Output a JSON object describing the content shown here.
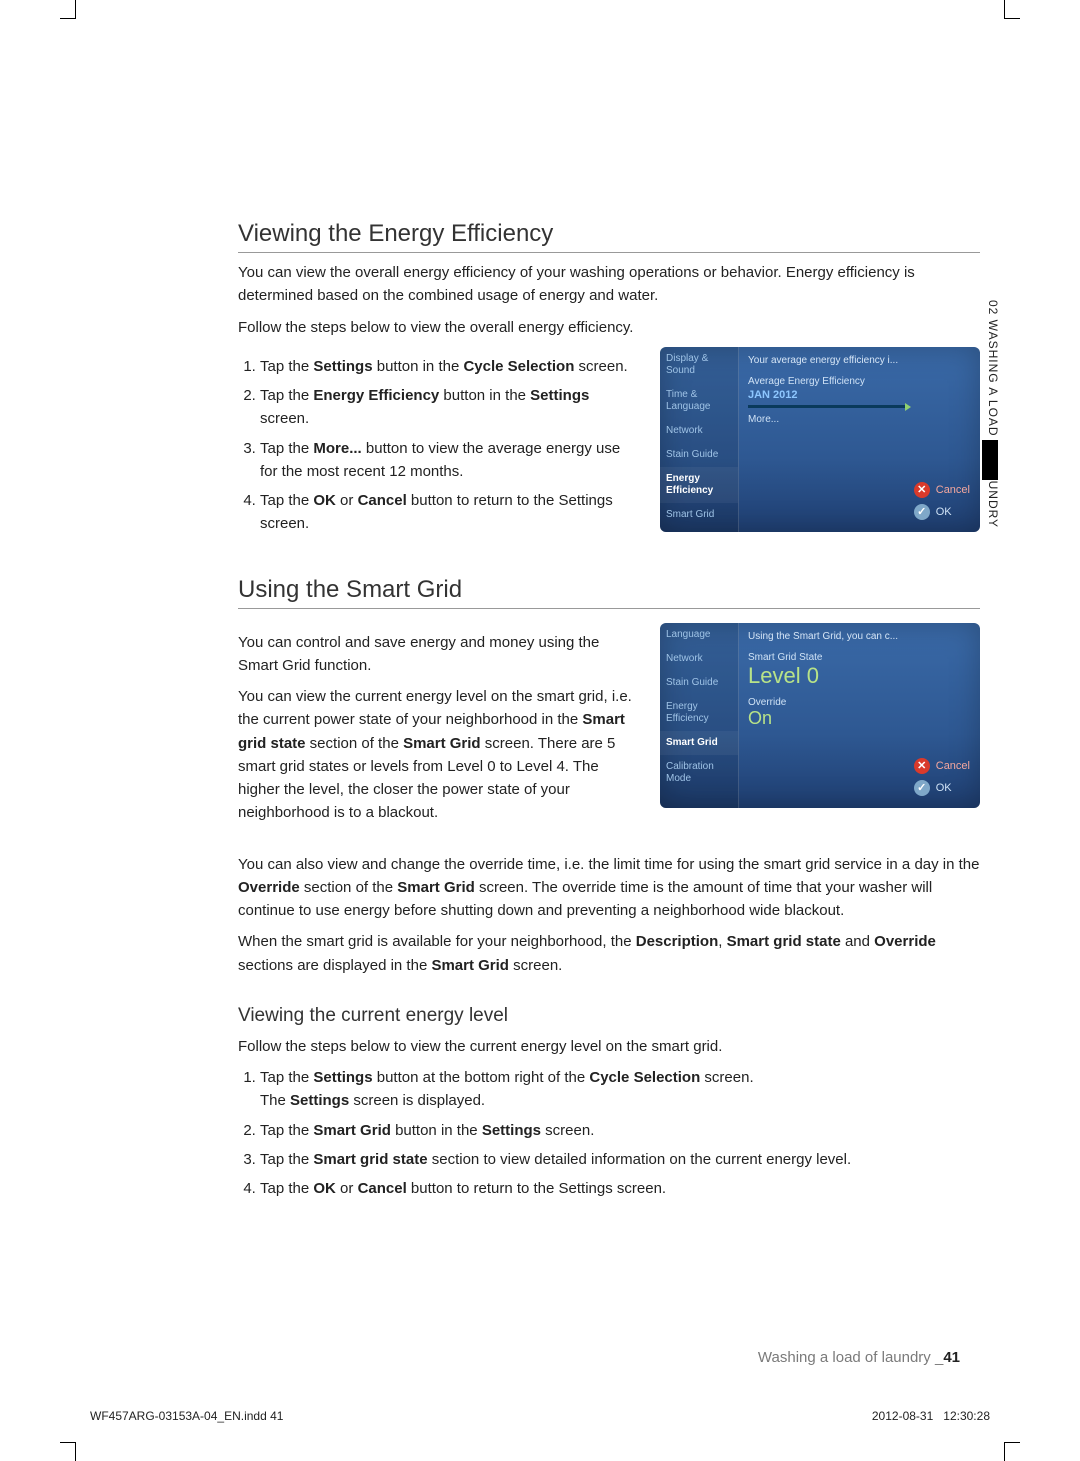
{
  "side_tab": "02 WASHING A LOAD OF LAUNDRY",
  "section1": {
    "title": "Viewing the Energy Efficiency",
    "para1": "You can view the overall energy efficiency of your washing operations or behavior. Energy efficiency is determined based on the combined usage of energy and water.",
    "para2": "Follow the steps below to view the overall energy efficiency.",
    "steps": [
      {
        "pre": "Tap the ",
        "b1": "Settings",
        "mid1": " button in the ",
        "b2": "Cycle Selection",
        "post": " screen."
      },
      {
        "pre": "Tap the ",
        "b1": "Energy Efficiency",
        "mid1": " button in the ",
        "b2": "Settings",
        "post": " screen."
      },
      {
        "pre": "Tap the ",
        "b1": "More...",
        "mid1": " button to view the average energy use for the most recent 12 months.",
        "b2": "",
        "post": ""
      },
      {
        "pre": "Tap the ",
        "b1": "OK",
        "mid1": " or ",
        "b2": "Cancel",
        "post": " button to return to the Settings screen."
      }
    ]
  },
  "screen1": {
    "sidebar": [
      "Display & Sound",
      "Time & Language",
      "Network",
      "Stain Guide",
      "Energy Efficiency",
      "Smart Grid"
    ],
    "desc": "Your average energy efficiency i...",
    "label": "Average Energy Efficiency",
    "month": "JAN 2012",
    "more": "More...",
    "cancel": "Cancel",
    "ok": "OK"
  },
  "section2": {
    "title": "Using the Smart Grid",
    "para1": "You can control and save energy and money using the Smart Grid function.",
    "para2a": "You can view the current energy level on the smart grid, i.e. the current power state of your neighborhood in the ",
    "para2b": "Smart grid state",
    "para2c": " section of the ",
    "para2d": "Smart Grid",
    "para2e": " screen. There are 5 smart grid states or levels from Level 0 to Level 4. The higher the level, the closer the power state of your neighborhood is to a blackout.",
    "para3a": "You can also view and change the override time, i.e. the limit time for using the smart grid service in a day in the ",
    "para3b": "Override",
    "para3c": " section of the ",
    "para3d": "Smart Grid",
    "para3e": " screen. The override time is the amount of time that your washer will continue to use energy before shutting down and preventing a neighborhood wide blackout.",
    "para4a": "When the smart grid is available for your neighborhood, the ",
    "para4b": "Description",
    "para4c": ", ",
    "para4d": "Smart grid state",
    "para4e": " and ",
    "para4f": "Override",
    "para4g": " sections are displayed in the ",
    "para4h": "Smart Grid",
    "para4i": " screen."
  },
  "screen2": {
    "sidebar": [
      "Language",
      "Network",
      "Stain Guide",
      "Energy Efficiency",
      "Smart Grid",
      "Calibration Mode"
    ],
    "desc": "Using the Smart Grid, you can c...",
    "state_label": "Smart Grid State",
    "state_value": "Level 0",
    "override_label": "Override",
    "override_value": "On",
    "cancel": "Cancel",
    "ok": "OK"
  },
  "section3": {
    "title": "Viewing the current energy level",
    "intro": "Follow the steps below to view the current energy level on the smart grid.",
    "steps": [
      {
        "line1a": "Tap the ",
        "line1b": "Settings",
        "line1c": " button at the bottom right of the ",
        "line1d": "Cycle Selection",
        "line1e": " screen.",
        "line2a": "The ",
        "line2b": "Settings",
        "line2c": " screen is displayed."
      },
      {
        "line1a": "Tap the ",
        "line1b": "Smart Grid",
        "line1c": " button in the ",
        "line1d": "Settings",
        "line1e": " screen."
      },
      {
        "line1a": "Tap the ",
        "line1b": "Smart grid state",
        "line1c": " section to view detailed information on the current energy level.",
        "line1d": "",
        "line1e": ""
      },
      {
        "line1a": "Tap the ",
        "line1b": "OK",
        "line1c": " or ",
        "line1d": "Cancel",
        "line1e": " button to return to the Settings screen."
      }
    ]
  },
  "footer": {
    "chapter": "Washing a load of laundry _",
    "page": "41",
    "imprint_left": "WF457ARG-03153A-04_EN.indd   41",
    "imprint_date": "2012-08-31",
    "imprint_time": "12:30:28"
  }
}
